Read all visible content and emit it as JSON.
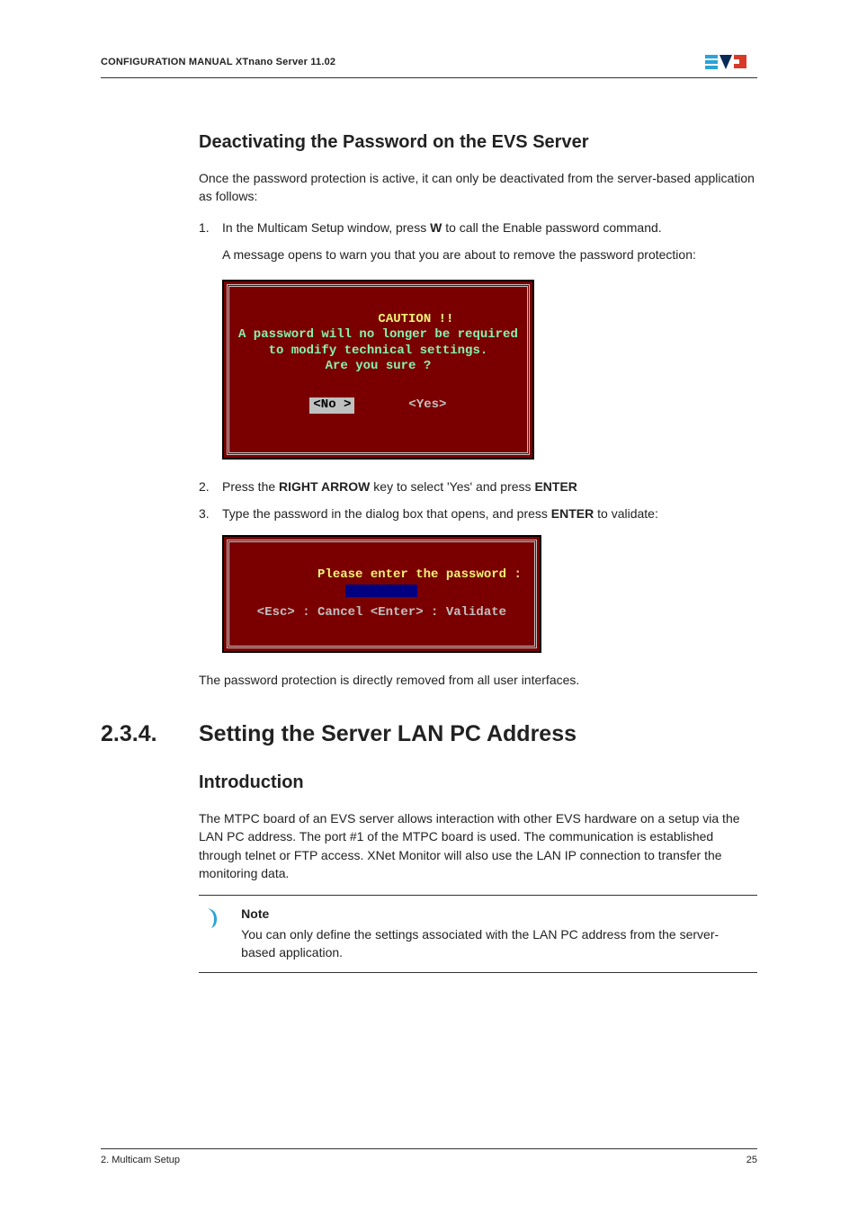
{
  "header": {
    "title": "CONFIGURATION MANUAL  XTnano Server 11.02"
  },
  "h3_1": "Deactivating the Password on the EVS Server",
  "intro1": "Once the password protection is active, it can only be deactivated from the server-based application as follows:",
  "step1_a": "In the Multicam Setup window, press ",
  "step1_key": "W",
  "step1_b": " to call the Enable password command.",
  "step1_sub": "A message opens to warn you that you are about to remove the password protection:",
  "console1": {
    "l1": "CAUTION !!",
    "l2": "A password will no longer be required",
    "l3": "to modify technical settings.",
    "l4": "Are you sure ?",
    "no": "<No >",
    "yes": "<Yes>"
  },
  "step2_a": "Press the ",
  "step2_key": "RIGHT ARROW",
  "step2_b": " key to select 'Yes' and press ",
  "step2_key2": "ENTER",
  "step3_a": "Type the password in the dialog box that opens, and press ",
  "step3_key": "ENTER",
  "step3_b": " to validate:",
  "console2": {
    "l1": "Please enter the password :",
    "l2": "<Esc> : Cancel <Enter> : Validate"
  },
  "after_console2": "The password protection is directly removed from all user interfaces.",
  "section": {
    "num": "2.3.4.",
    "title": "Setting the Server LAN PC Address"
  },
  "h3_2": "Introduction",
  "intro2": "The MTPC board of an EVS server allows interaction with other EVS hardware on a setup via the LAN PC address. The port #1 of the MTPC board is used. The communication is established through telnet or FTP access. XNet Monitor will also use the LAN IP connection to transfer the monitoring data.",
  "note": {
    "label": "Note",
    "text": "You can only define the settings associated with the LAN PC address from the server-based application."
  },
  "footer": {
    "left": "2. Multicam Setup",
    "right": "25"
  }
}
